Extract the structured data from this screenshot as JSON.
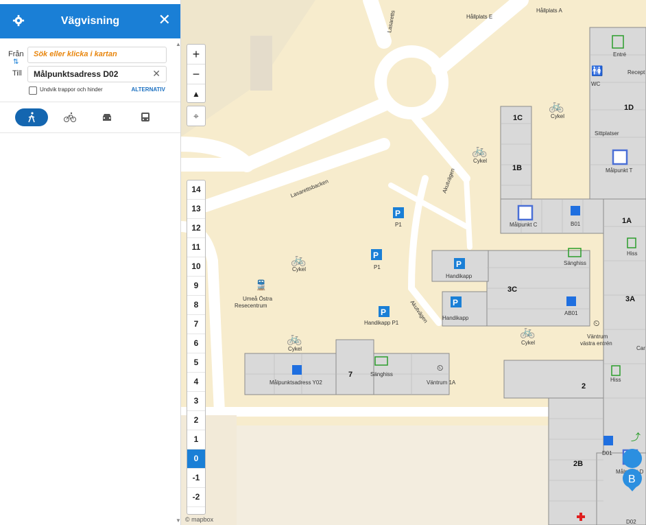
{
  "header": {
    "title": "Vägvisning"
  },
  "route": {
    "from_label": "Från",
    "from_placeholder": "Sök eller klicka i kartan",
    "to_label": "Till",
    "to_value": "Målpunktsadress D02",
    "avoid_label": "Undvik trappor och hinder",
    "alternatives_label": "ALTERNATIV"
  },
  "modes": [
    {
      "name": "walk",
      "icon": "walk-icon",
      "active": true
    },
    {
      "name": "bike",
      "icon": "bike-icon",
      "active": false
    },
    {
      "name": "car",
      "icon": "car-icon",
      "active": false
    },
    {
      "name": "bus",
      "icon": "bus-icon",
      "active": false
    }
  ],
  "map_controls": {
    "zoom_in": "+",
    "zoom_out": "−",
    "compass": "▲"
  },
  "floors": [
    "14",
    "13",
    "12",
    "11",
    "10",
    "9",
    "8",
    "7",
    "6",
    "5",
    "4",
    "3",
    "2",
    "1",
    "0",
    "-1",
    "-2"
  ],
  "selected_floor": "0",
  "attribution": "© mapbox",
  "map_labels": {
    "hallplats_e": "Hållplats E",
    "hallplats_a": "Hållplats A",
    "lasarettsbacken": "Lasarettsbacken",
    "akutvagen_1": "Akutvägen",
    "akutvagen_2": "Akutvägen",
    "lasarettsg": "Lasaretts",
    "entre": "Entré",
    "wc": "WC",
    "recept": "Recept",
    "b1c": "1C",
    "b1d": "1D",
    "b1b": "1B",
    "b1a": "1A",
    "b3c": "3C",
    "b3a": "3A",
    "b2": "2",
    "b2b": "2B",
    "b7": "7",
    "cykel": "Cykel",
    "sittplatser": "Sittplatser",
    "malpunkt_t": "Målpunkt T",
    "malpunkt_c": "Målpunkt C",
    "b01": "B01",
    "hiss": "Hiss",
    "p1": "P1",
    "sanghiss": "Sänghiss",
    "handikapp": "Handikapp",
    "handikapp_p1": "Handikapp P1",
    "ab01": "AB01",
    "vantrum_vastra": "Väntrum",
    "vantrum_vastra_2": "västra entrén",
    "umea_ostra": "Umeå Östra",
    "resecentrum": "Resecentrum",
    "malpunktsadress_y02": "Målpunktsadress Y02",
    "vantrum_1a": "Väntrum 1A",
    "d01": "D01",
    "d02": "D02",
    "malpunkt_d": "Målpunkt D",
    "car": "Car",
    "b_marker": "B"
  }
}
